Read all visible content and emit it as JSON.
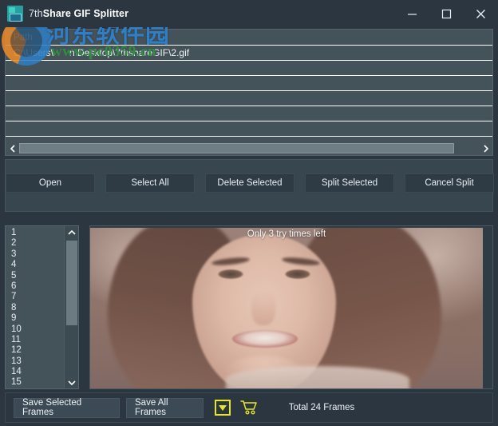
{
  "window": {
    "title_prefix": "7th",
    "title_main": "Share GIF Splitter",
    "app_icon": "gif-splitter-app-icon",
    "controls": {
      "minimize": "minimize-icon",
      "maximize": "maximize-icon",
      "close": "close-icon"
    }
  },
  "watermark": {
    "site_name": "河东软件园",
    "site_url": "www.pc0359.cn",
    "logo": "pc0359-logo"
  },
  "file_list": {
    "column_header": "Path",
    "rows": [
      {
        "path": "C:\\Users\\      n\\Desktop\\7thshareGIF\\2.gif"
      },
      {
        "path": ""
      },
      {
        "path": ""
      },
      {
        "path": ""
      },
      {
        "path": ""
      },
      {
        "path": ""
      },
      {
        "path": ""
      }
    ],
    "hscroll": {
      "left_arrow": "chevron-left-icon",
      "right_arrow": "chevron-right-icon"
    }
  },
  "toolbar": {
    "buttons": [
      {
        "label": "Open",
        "name": "open-button"
      },
      {
        "label": "Select All",
        "name": "select-all-button"
      },
      {
        "label": "Delete Selected",
        "name": "delete-selected-button"
      },
      {
        "label": "Split Selected",
        "name": "split-selected-button"
      },
      {
        "label": "Cancel Split",
        "name": "cancel-split-button"
      }
    ]
  },
  "frames": {
    "numbers": [
      "1",
      "2",
      "3",
      "4",
      "5",
      "6",
      "7",
      "8",
      "9",
      "10",
      "11",
      "12",
      "13",
      "14",
      "15"
    ],
    "vscroll": {
      "up_arrow": "chevron-up-icon",
      "down_arrow": "chevron-down-icon"
    }
  },
  "preview": {
    "trial_notice": "Only 3 try times left",
    "image_alt": "gif-frame-preview"
  },
  "statusbar": {
    "save_selected_label": "Save Selected Frames",
    "save_all_label": "Save All Frames",
    "dropdown_icon": "dropdown-triangle-icon",
    "cart_icon": "shopping-cart-icon",
    "total_text": "Total 24 Frames"
  },
  "colors": {
    "window_bg": "#2b3640",
    "panel_bg": "#44525a",
    "button_bg": "#2e3a44",
    "accent_yellow": "#e8e81c",
    "text": "#eef3f7"
  }
}
